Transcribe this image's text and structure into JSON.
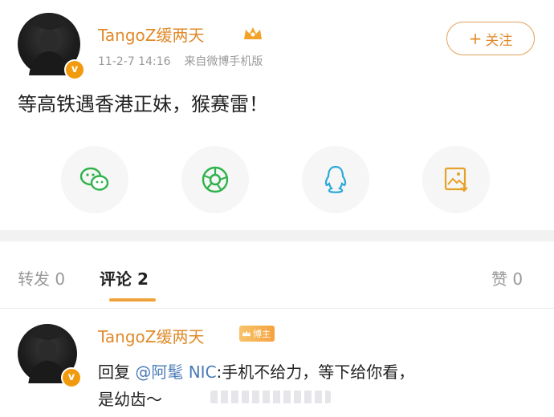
{
  "post": {
    "username": "TangoZ缓两天",
    "timestamp": "11-2-7 14:16",
    "source": "来自微博手机版",
    "follow_label": "关注",
    "follow_icon": "plus-icon",
    "text": "等高铁遇香港正妹，猴赛雷！"
  },
  "share": {
    "items": [
      {
        "icon": "wechat-icon",
        "color": "#2fb24a"
      },
      {
        "icon": "moments-icon",
        "color": "#2fb24a"
      },
      {
        "icon": "qq-icon",
        "color": "#2aa9d9"
      },
      {
        "icon": "save-image-icon",
        "color": "#e6a12a"
      }
    ]
  },
  "tabs": {
    "repost": "转发 0",
    "comments": "评论 2",
    "likes": "赞 0"
  },
  "comment": {
    "username": "TangoZ缓两天",
    "owner_badge": "博主",
    "reply_prefix": "回复",
    "mention": "@阿髦 NIC",
    "body_line1": ":手机不给力，等下给你看，",
    "body_line2": "是幼齿～"
  },
  "colors": {
    "accent": "#e08a2a",
    "verified_badge": "#f29a0e",
    "tab_underline": "#f0a33a",
    "mention": "#4a7bb8"
  }
}
